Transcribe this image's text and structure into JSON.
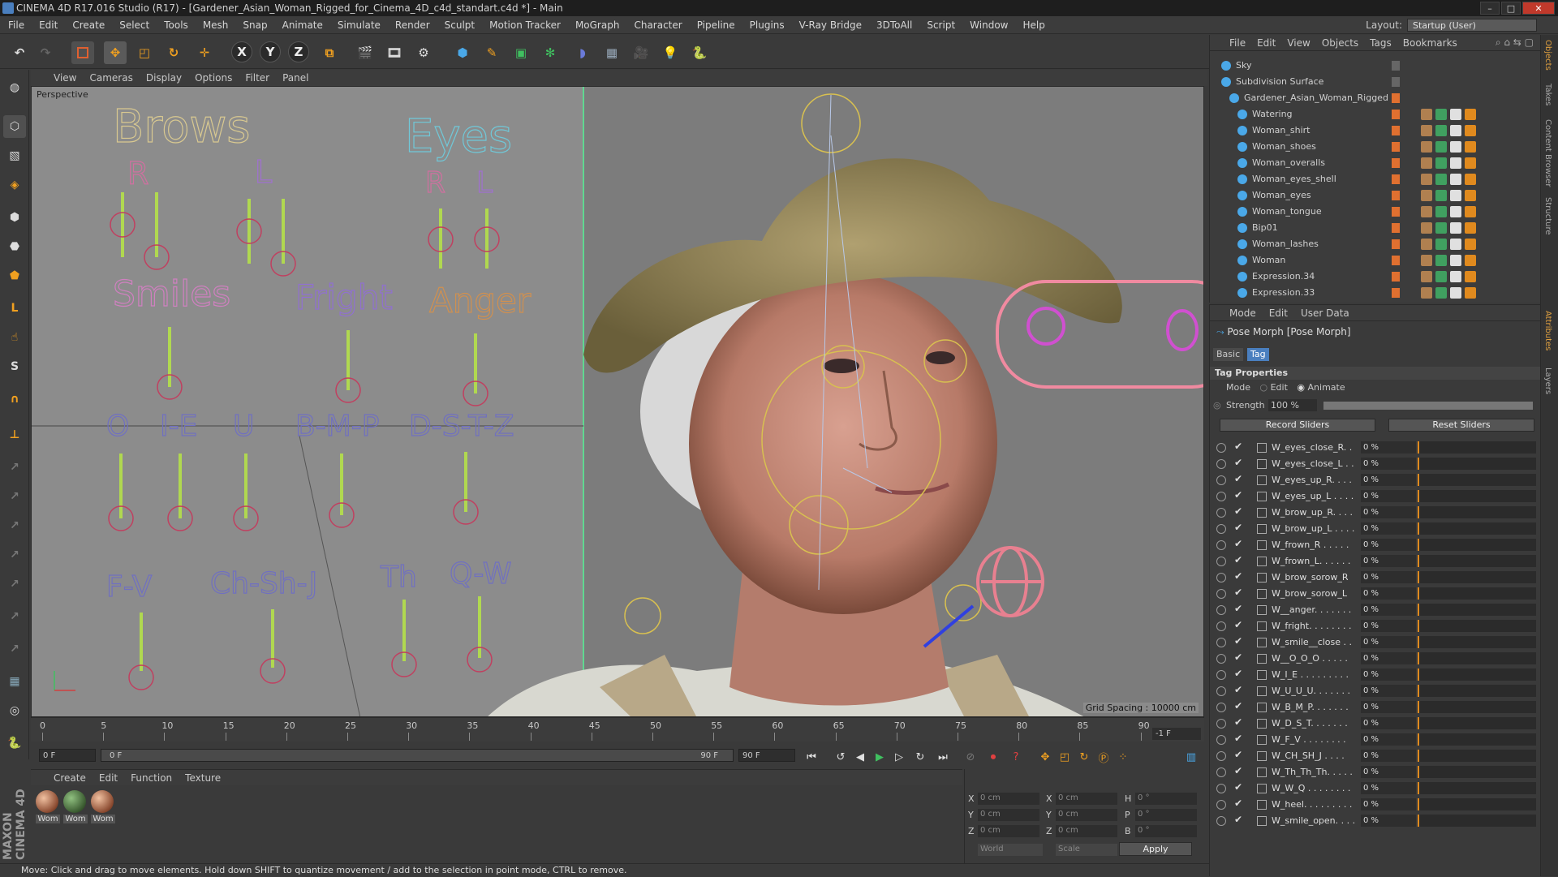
{
  "window": {
    "title": "CINEMA 4D R17.016 Studio (R17) - [Gardener_Asian_Woman_Rigged_for_Cinema_4D_c4d_standart.c4d *] - Main"
  },
  "menu": [
    "File",
    "Edit",
    "Create",
    "Select",
    "Tools",
    "Mesh",
    "Snap",
    "Animate",
    "Simulate",
    "Render",
    "Sculpt",
    "Motion Tracker",
    "MoGraph",
    "Character",
    "Pipeline",
    "Plugins",
    "V-Ray Bridge",
    "3DToAll",
    "Script",
    "Window",
    "Help"
  ],
  "layout": {
    "label": "Layout:",
    "value": "Startup (User)"
  },
  "toolbar": {
    "x": "X",
    "y": "Y",
    "z": "Z"
  },
  "viewport": {
    "menu": [
      "View",
      "Cameras",
      "Display",
      "Options",
      "Filter",
      "Panel"
    ],
    "label": "Perspective",
    "grid_spacing": "Grid Spacing : 10000 cm",
    "rig_labels": {
      "brows": "Brows",
      "brows_r": "R",
      "brows_l": "L",
      "eyes": "Eyes",
      "eyes_r": "R",
      "eyes_l": "L",
      "smiles": "Smiles",
      "fright": "Fright",
      "anger": "Anger",
      "o": "O",
      "ie": "I-E",
      "u": "U",
      "bmp": "B-M-P",
      "dstz": "D-S-T-Z",
      "fv": "F-V",
      "chshj": "Ch-Sh-J",
      "th": "Th",
      "qw": "Q-W"
    }
  },
  "timeline": {
    "ticks": [
      "0",
      "5",
      "10",
      "15",
      "20",
      "25",
      "30",
      "35",
      "40",
      "45",
      "50",
      "55",
      "60",
      "65",
      "70",
      "75",
      "80",
      "85",
      "90"
    ],
    "frame_end_display": "-1 F",
    "current": "0 F",
    "range_start": "0 F",
    "range_end": "90 F",
    "max": "90 F"
  },
  "material_manager": {
    "menu": [
      "Create",
      "Edit",
      "Function",
      "Texture"
    ],
    "materials": [
      "Wom",
      "Wom",
      "Wom"
    ]
  },
  "coordinates": {
    "x_pos": "0 cm",
    "y_pos": "0 cm",
    "z_pos": "0 cm",
    "x_size": "0 cm",
    "y_size": "0 cm",
    "z_size": "0 cm",
    "h": "0 °",
    "p": "0 °",
    "b": "0 °",
    "mode1": "World",
    "mode2": "Scale",
    "apply": "Apply",
    "lx": "X",
    "ly": "Y",
    "lz": "Z",
    "lx2": "X",
    "ly2": "Y",
    "lz2": "Z",
    "lh": "H",
    "lp": "P",
    "lb": "B"
  },
  "status": "Move: Click and drag to move elements. Hold down SHIFT to quantize movement / add to the selection in point mode, CTRL to remove.",
  "object_manager": {
    "menu": [
      "File",
      "Edit",
      "View",
      "Objects",
      "Tags",
      "Bookmarks"
    ],
    "objects": [
      {
        "name": "Sky",
        "indent": 0
      },
      {
        "name": "Subdivision Surface",
        "indent": 0
      },
      {
        "name": "Gardener_Asian_Woman_Rigged",
        "indent": 1
      },
      {
        "name": "Watering",
        "indent": 2
      },
      {
        "name": "Woman_shirt",
        "indent": 2
      },
      {
        "name": "Woman_shoes",
        "indent": 2
      },
      {
        "name": "Woman_overalls",
        "indent": 2
      },
      {
        "name": "Woman_eyes_shell",
        "indent": 2
      },
      {
        "name": "Woman_eyes",
        "indent": 2
      },
      {
        "name": "Woman_tongue",
        "indent": 2
      },
      {
        "name": "Bip01",
        "indent": 2
      },
      {
        "name": "Woman_lashes",
        "indent": 2
      },
      {
        "name": "Woman",
        "indent": 2
      },
      {
        "name": "Expression.34",
        "indent": 2
      },
      {
        "name": "Expression.33",
        "indent": 2
      }
    ]
  },
  "attributes": {
    "menu": [
      "Mode",
      "Edit",
      "User Data"
    ],
    "title": "Pose Morph [Pose Morph]",
    "tabs": [
      "Basic",
      "Tag"
    ],
    "section": "Tag Properties",
    "mode_label": "Mode",
    "mode_edit": "Edit",
    "mode_animate": "Animate",
    "strength_label": "Strength",
    "strength_value": "100 %",
    "record_sliders": "Record Sliders",
    "reset_sliders": "Reset Sliders",
    "sliders": [
      {
        "name": "W_eyes_close_R. .",
        "value": "0 %"
      },
      {
        "name": "W_eyes_close_L . .",
        "value": "0 %"
      },
      {
        "name": "W_eyes_up_R. . . .",
        "value": "0 %"
      },
      {
        "name": "W_eyes_up_L . . . .",
        "value": "0 %"
      },
      {
        "name": "W_brow_up_R. . . .",
        "value": "0 %"
      },
      {
        "name": "W_brow_up_L . . . .",
        "value": "0 %"
      },
      {
        "name": "W_frown_R . . . . .",
        "value": "0 %"
      },
      {
        "name": "W_frown_L. . . . . .",
        "value": "0 %"
      },
      {
        "name": "W_brow_sorow_R",
        "value": "0 %"
      },
      {
        "name": "W_brow_sorow_L",
        "value": "0 %"
      },
      {
        "name": "W__anger. . . . . . .",
        "value": "0 %"
      },
      {
        "name": "W_fright. . . . . . . .",
        "value": "0 %"
      },
      {
        "name": "W_smile__close . .",
        "value": "0 %"
      },
      {
        "name": "W__O_O_O . . . . .",
        "value": "0 %"
      },
      {
        "name": "W_I_E . . . . . . . . .",
        "value": "0 %"
      },
      {
        "name": "W_U_U_U. . . . . . .",
        "value": "0 %"
      },
      {
        "name": "W_B_M_P. . . . . . .",
        "value": "0 %"
      },
      {
        "name": "W_D_S_T. . . . . . .",
        "value": "0 %"
      },
      {
        "name": "W_F_V . . . . . . . .",
        "value": "0 %"
      },
      {
        "name": "W_CH_SH_J . . . .",
        "value": "0 %"
      },
      {
        "name": "W_Th_Th_Th. . . . .",
        "value": "0 %"
      },
      {
        "name": "W_W_Q . . . . . . . .",
        "value": "0 %"
      },
      {
        "name": "W_heel. . . . . . . . .",
        "value": "0 %"
      },
      {
        "name": "W_smile_open. . . .",
        "value": "0 %"
      }
    ]
  },
  "side_tabs": [
    "Objects",
    "Takes",
    "Content Browser",
    "Structure",
    "Attributes",
    "Layers"
  ]
}
